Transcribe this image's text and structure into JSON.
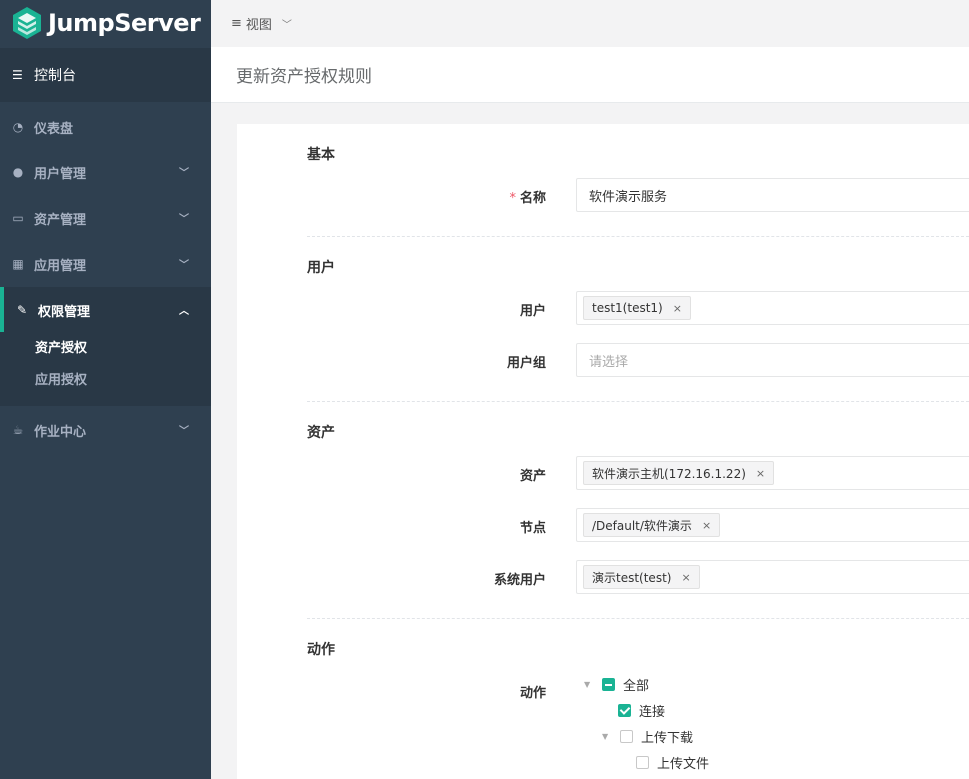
{
  "brand": {
    "name": "JumpServer",
    "accent": "#1ab394"
  },
  "sidebar": {
    "console": "控制台",
    "items": [
      {
        "label": "仪表盘",
        "icon": "dashboard-icon"
      },
      {
        "label": "用户管理",
        "icon": "users-icon"
      },
      {
        "label": "资产管理",
        "icon": "inbox-icon"
      },
      {
        "label": "应用管理",
        "icon": "grid-icon"
      },
      {
        "label": "权限管理",
        "icon": "edit-icon"
      },
      {
        "label": "作业中心",
        "icon": "coffee-icon"
      }
    ],
    "subitems": [
      {
        "label": "资产授权"
      },
      {
        "label": "应用授权"
      }
    ]
  },
  "topbar": {
    "view_label": "视图"
  },
  "page": {
    "title": "更新资产授权规则"
  },
  "form": {
    "basic": {
      "section": "基本",
      "name_label": "名称",
      "name_value": "软件演示服务"
    },
    "user": {
      "section": "用户",
      "users_label": "用户",
      "users_tags": [
        "test1(test1)"
      ],
      "groups_label": "用户组",
      "groups_placeholder": "请选择"
    },
    "asset": {
      "section": "资产",
      "assets_label": "资产",
      "assets_tags": [
        "软件演示主机(172.16.1.22)"
      ],
      "nodes_label": "节点",
      "nodes_tags": [
        "/Default/软件演示"
      ],
      "sysusers_label": "系统用户",
      "sysusers_tags": [
        "演示test(test)"
      ]
    },
    "action": {
      "section": "动作",
      "label": "动作",
      "tree": [
        {
          "label": "全部",
          "state": "partial"
        },
        {
          "label": "连接",
          "state": "checked"
        },
        {
          "label": "上传下载",
          "state": "unchecked"
        },
        {
          "label": "上传文件",
          "state": "unchecked"
        }
      ]
    }
  }
}
